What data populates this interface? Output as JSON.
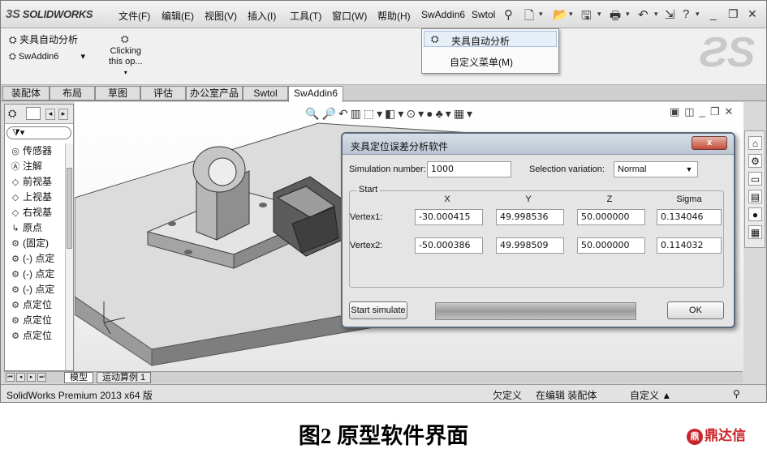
{
  "app": {
    "logo_prefix": "3S",
    "logo_name": "SOLIDWORKS"
  },
  "menu": {
    "items": [
      "文件(F)",
      "编辑(E)",
      "视图(V)",
      "插入(I)",
      "工具(T)",
      "窗口(W)",
      "帮助(H)",
      "SwAddin6",
      "Swtol"
    ]
  },
  "command_manager": {
    "fixture_analysis": "夹具自动分析",
    "swaddin6": "SwAddin6",
    "clicking_line1": "Clicking",
    "clicking_line2": "this op..."
  },
  "popup": {
    "item1": "夹具自动分析",
    "item2": "自定义菜单(M)"
  },
  "tabs": [
    "装配体",
    "布局",
    "草图",
    "评估",
    "办公室产品",
    "Swtol",
    "SwAddin6"
  ],
  "active_tab": "SwAddin6",
  "tree": {
    "items": [
      "传感器",
      "注解",
      "前视基",
      "上视基",
      "右视基",
      "原点",
      "(固定)",
      "(-) 点定",
      "(-) 点定",
      "(-) 点定",
      "点定位",
      "点定位",
      "点定位"
    ]
  },
  "dialog": {
    "title": "夹具定位误差分析软件",
    "close_label": "x",
    "sim_number_label": "Simulation number:",
    "sim_number_value": "1000",
    "selection_label": "Selection variation:",
    "selection_value": "Normal",
    "group_label": "Start",
    "columns": [
      "X",
      "Y",
      "Z",
      "Sigma"
    ],
    "rows": [
      {
        "label": "Vertex1:",
        "x": "-30.000415",
        "y": "49.998536",
        "z": "50.000000",
        "sigma": "0.134046"
      },
      {
        "label": "Vertex2:",
        "x": "-50.000386",
        "y": "49.998509",
        "z": "50.000000",
        "sigma": "0.114032"
      }
    ],
    "start_button": "Start simulate",
    "ok_button": "OK",
    "progress_fraction": 1.0
  },
  "sheet_tabs": [
    "模型",
    "运动算例 1"
  ],
  "status": {
    "product": "SolidWorks Premium 2013 x64 版",
    "underdefined": "欠定义",
    "editing": "在编辑 装配体",
    "custom": "自定义 ▲"
  },
  "caption": "图2  原型软件界面",
  "brand": "鼎达信",
  "colors": {
    "brand_red": "#c8242a",
    "dialog_close": "#c44a36"
  }
}
